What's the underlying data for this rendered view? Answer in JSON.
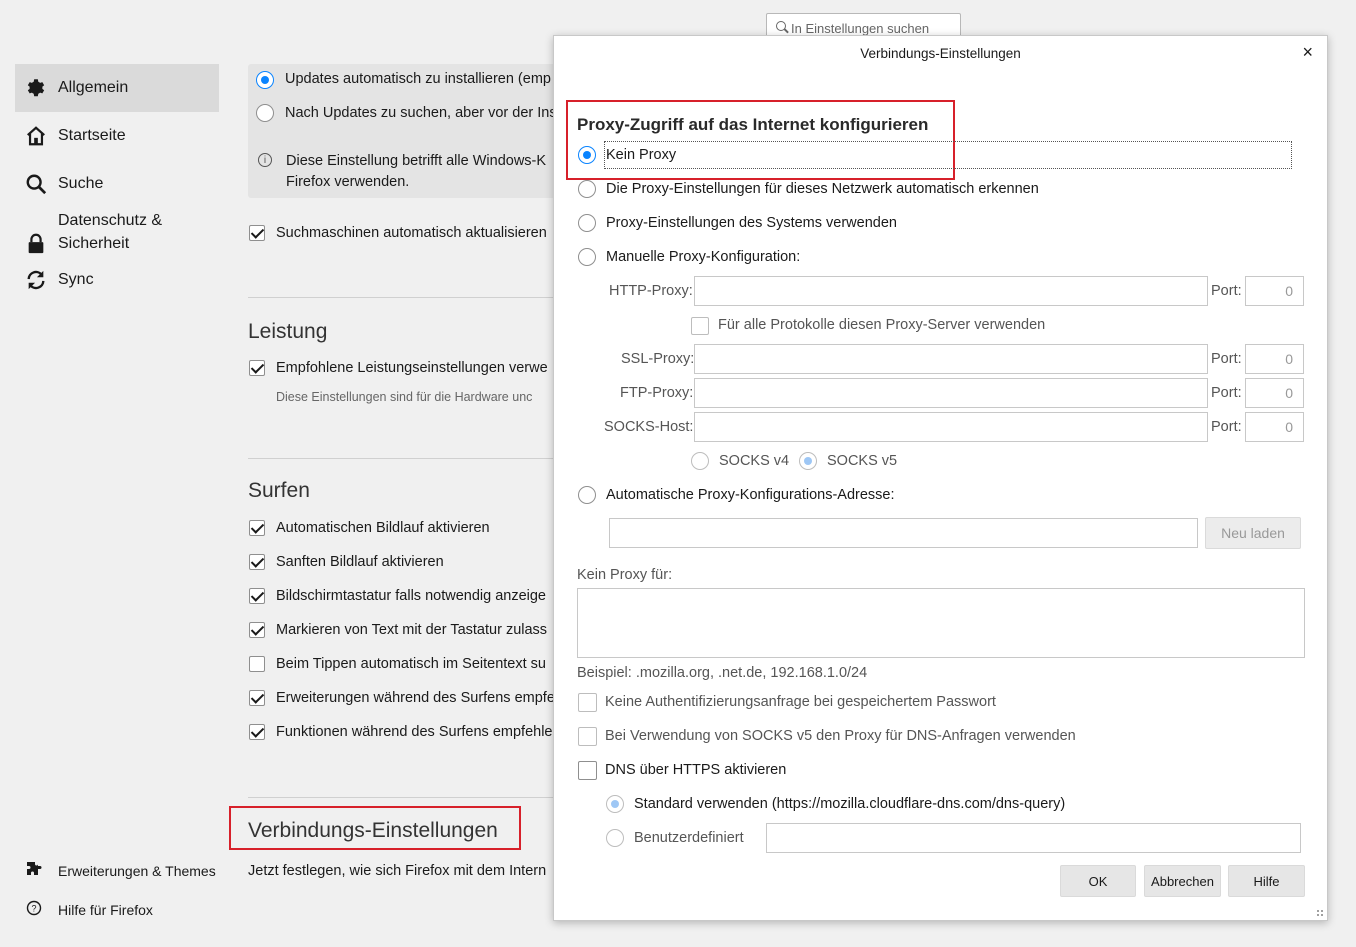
{
  "search": {
    "placeholder": "In Einstellungen suchen"
  },
  "sidebar": {
    "items": [
      {
        "label": "Allgemein",
        "icon": "gear-icon",
        "active": true
      },
      {
        "label": "Startseite",
        "icon": "home-icon"
      },
      {
        "label": "Suche",
        "icon": "search-icon"
      },
      {
        "label": "Datenschutz & Sicherheit",
        "line1": "Datenschutz &",
        "line2": "Sicherheit",
        "icon": "lock-icon"
      },
      {
        "label": "Sync",
        "icon": "sync-icon"
      }
    ],
    "footer": [
      {
        "label": "Erweiterungen & Themes",
        "icon": "puzzle-icon"
      },
      {
        "label": "Hilfe für Firefox",
        "icon": "help-icon"
      }
    ]
  },
  "prefs": {
    "updates_auto": "Updates automatisch zu installieren (emp",
    "updates_check": "Nach Updates zu suchen, aber vor der Ins",
    "info_line1": "Diese Einstellung betrifft alle Windows-K",
    "info_line2": "Firefox verwenden.",
    "search_engines": "Suchmaschinen automatisch aktualisieren",
    "performance_heading": "Leistung",
    "performance_recommended": "Empfohlene Leistungseinstellungen verwe",
    "performance_note": "Diese Einstellungen sind für die Hardware unc",
    "browsing_heading": "Surfen",
    "browsing_items": [
      {
        "label": "Automatischen Bildlauf aktivieren",
        "checked": true
      },
      {
        "label": "Sanften Bildlauf aktivieren",
        "checked": true
      },
      {
        "label": "Bildschirmtastatur falls notwendig anzeige",
        "checked": true
      },
      {
        "label": "Markieren von Text mit der Tastatur zulass",
        "checked": true
      },
      {
        "label": "Beim Tippen automatisch im Seitentext su",
        "checked": false
      },
      {
        "label": "Erweiterungen während des Surfens empfe",
        "checked": true
      },
      {
        "label": "Funktionen während des Surfens empfehle",
        "checked": true
      }
    ],
    "network_heading": "Verbindungs-Einstellungen",
    "network_desc": "Jetzt festlegen, wie sich Firefox mit dem Intern"
  },
  "dialog": {
    "title": "Verbindungs-Einstellungen",
    "close": "×",
    "section_heading": "Proxy-Zugriff auf das Internet konfigurieren",
    "options": {
      "no_proxy": "Kein Proxy",
      "auto_detect": "Die Proxy-Einstellungen für dieses Netzwerk automatisch erkennen",
      "system": "Proxy-Einstellungen des Systems verwenden",
      "manual": "Manuelle Proxy-Konfiguration:",
      "auto_url": "Automatische Proxy-Konfigurations-Adresse:"
    },
    "selected_option": "no_proxy",
    "http_label": "HTTP-Proxy:",
    "ssl_label": "SSL-Proxy:",
    "ftp_label": "FTP-Proxy:",
    "socks_label": "SOCKS-Host:",
    "port_label": "Port:",
    "port_values": {
      "http": "0",
      "ssl": "0",
      "ftp": "0",
      "socks": "0"
    },
    "share_all": "Für alle Protokolle diesen Proxy-Server verwenden",
    "socks_v4": "SOCKS v4",
    "socks_v5": "SOCKS v5",
    "reload": "Neu laden",
    "no_proxy_for": "Kein Proxy für:",
    "example": "Beispiel: .mozilla.org, .net.de, 192.168.1.0/24",
    "auth_prompt": "Keine Authentifizierungsanfrage bei gespeichertem Passwort",
    "socks_dns": "Bei Verwendung von SOCKS v5 den Proxy für DNS-Anfragen verwenden",
    "doh": "DNS über HTTPS aktivieren",
    "doh_default": "Standard verwenden (https://mozilla.cloudflare-dns.com/dns-query)",
    "doh_custom": "Benutzerdefiniert",
    "buttons": {
      "ok": "OK",
      "cancel": "Abbrechen",
      "help": "Hilfe"
    }
  },
  "colors": {
    "accent": "#0a84ff",
    "highlight_border": "#d7202a"
  }
}
